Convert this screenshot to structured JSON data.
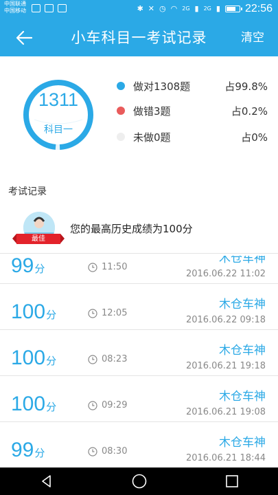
{
  "status_bar": {
    "carrier_1": "中国联通",
    "carrier_2": "中国移动",
    "signal_label_1": "2G",
    "signal_label_2": "2G",
    "time": "22:56",
    "battery_level": 0.8
  },
  "header": {
    "title": "小车科目一考试记录",
    "clear_label": "清空"
  },
  "summary": {
    "total": "1311",
    "subject": "科目一",
    "legend": [
      {
        "label": "做对1308题",
        "percent": "占99.8%",
        "color": "#2ba9e6"
      },
      {
        "label": "做错3题",
        "percent": "占0.2%",
        "color": "#e95b5b"
      },
      {
        "label": "未做0题",
        "percent": "占0%",
        "color": "#eeeeee"
      }
    ],
    "ring_fraction": 0.998
  },
  "section": {
    "title": "考试记录"
  },
  "best": {
    "badge": "最佳",
    "text": "您的最高历史成绩为100分"
  },
  "records": [
    {
      "score": "99",
      "unit": "分",
      "duration": "11:50",
      "name": "木仓车神",
      "date": "2016.06.22  11:02"
    },
    {
      "score": "100",
      "unit": "分",
      "duration": "12:05",
      "name": "木仓车神",
      "date": "2016.06.22  09:18"
    },
    {
      "score": "100",
      "unit": "分",
      "duration": "08:23",
      "name": "木仓车神",
      "date": "2016.06.21  19:18"
    },
    {
      "score": "100",
      "unit": "分",
      "duration": "09:29",
      "name": "木仓车神",
      "date": "2016.06.21  19:08"
    },
    {
      "score": "99",
      "unit": "分",
      "duration": "08:30",
      "name": "木仓车神",
      "date": "2016.06.21  18:44"
    }
  ],
  "colors": {
    "accent": "#2ba9e6",
    "wrong": "#e95b5b",
    "ribbon": "#e3232b"
  }
}
